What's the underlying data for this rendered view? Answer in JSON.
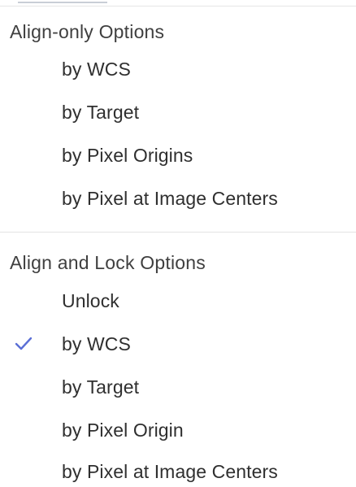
{
  "menu": {
    "align_only_header": "Align-only Options",
    "align_only_items": [
      {
        "label": "by WCS",
        "checked": false
      },
      {
        "label": "by Target",
        "checked": false
      },
      {
        "label": "by Pixel Origins",
        "checked": false
      },
      {
        "label": "by Pixel at Image Centers",
        "checked": false
      }
    ],
    "align_lock_header": "Align and Lock Options",
    "align_lock_items": [
      {
        "label": "Unlock",
        "checked": false
      },
      {
        "label": "by WCS",
        "checked": true
      },
      {
        "label": "by Target",
        "checked": false
      },
      {
        "label": "by Pixel Origin",
        "checked": false
      },
      {
        "label": "by Pixel at Image Centers",
        "checked": false
      }
    ],
    "check_icon": "checkmark-icon",
    "check_color": "#5b6fd6"
  }
}
